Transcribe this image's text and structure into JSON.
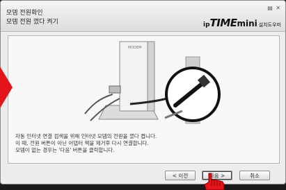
{
  "header": {
    "title_line1": "모뎀 전원확인",
    "title_line2": "모뎀 전원 껐다 켜기",
    "window_controls": "▤ ✕",
    "brand": {
      "ip": "ip",
      "time": "TIME",
      "mini": "mini",
      "wizard": "설치도우미"
    }
  },
  "illustration": {
    "device_label": "MODEM"
  },
  "instructions": [
    "자동 인터넷 연결 검색을 위해 인터넷 모뎀의 전원을 껐다 켭니다.",
    "이 때, 전원 버튼이 아닌 어댑터 잭을 제거후 다시 연결합니다.",
    "모뎀이 없는 경우는 '다음' 버튼을 클릭합니다."
  ],
  "buttons": {
    "prev": "< 이전",
    "next": "다음 >",
    "cancel": "취소"
  },
  "colors": {
    "arrow": "#e4141b",
    "cursor": "#e4141b"
  }
}
